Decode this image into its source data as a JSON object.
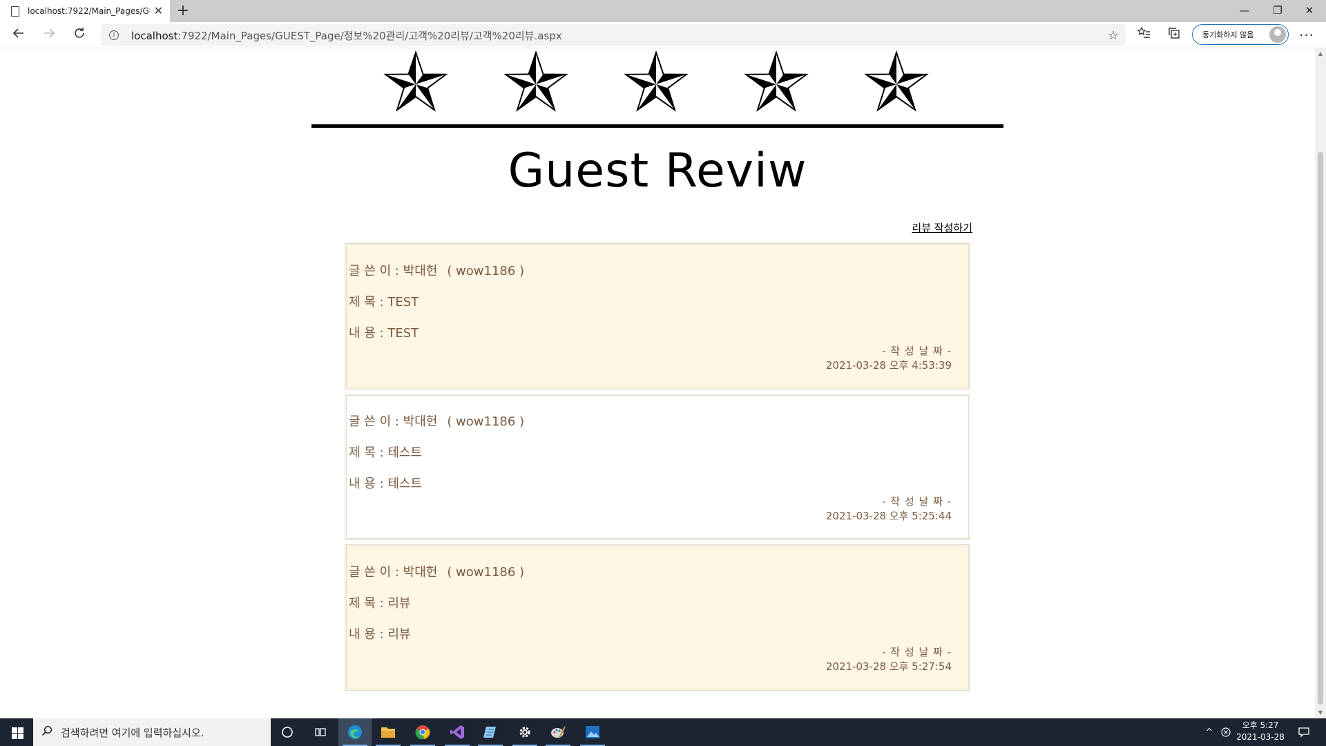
{
  "browser": {
    "tab_title": "localhost:7922/Main_Pages/GUES",
    "tab_close": "✕",
    "new_tab": "+",
    "url_host": "localhost",
    "url_rest": ":7922/Main_Pages/GUEST_Page/정보%20관리/고객%20리뷰/고객%20리뷰.aspx",
    "sync_label": "동기화하지 않음",
    "window_controls": {
      "minimize": "—",
      "restore": "❐",
      "close": "✕"
    },
    "icons": {
      "back": "back-arrow-icon",
      "forward": "forward-arrow-icon",
      "refresh": "refresh-icon",
      "info": "info-icon",
      "favorite": "star-outline-icon",
      "favorites_list": "favorites-icon",
      "collections": "collections-icon",
      "more": "more-icon"
    }
  },
  "page": {
    "rating_stars": 5,
    "title": "Guest Reviw",
    "write_link": "리뷰 작성하기"
  },
  "reviews": [
    {
      "author": "글 쓴 이 : 박대헌",
      "user_id": "( wow1186 )",
      "subject": "제 목 : TEST",
      "content": "내 용 : TEST",
      "date_label": "- 작 성 날 짜 -",
      "date": "2021-03-28 오후 4:53:39",
      "background": "#fff6e6"
    },
    {
      "author": "글 쓴 이 : 박대헌",
      "user_id": "( wow1186 )",
      "subject": "제 목 : 테스트",
      "content": "내 용 : 테스트",
      "date_label": "- 작 성 날 짜 -",
      "date": "2021-03-28 오후 5:25:44",
      "background": "#ffffff"
    },
    {
      "author": "글 쓴 이 : 박대헌",
      "user_id": "( wow1186 )",
      "subject": "제 목 : 리뷰",
      "content": "내 용 : 리뷰",
      "date_label": "- 작 성 날 짜 -",
      "date": "2021-03-28 오후 5:27:54",
      "background": "#fff6e6"
    }
  ],
  "colors": {
    "review_text": "#7b5a40",
    "review_alt_bg": "#fff6e6",
    "taskbar": "#1c2432",
    "sync_border": "#2b6fb0"
  },
  "taskbar": {
    "search_placeholder": "검색하려면 여기에 입력하십시오.",
    "apps": [
      "cortana-icon",
      "task-view-icon",
      "edge-icon",
      "file-explorer-icon",
      "chrome-icon",
      "visual-studio-icon",
      "notepad-icon",
      "settings-icon",
      "paint-icon",
      "photos-icon"
    ],
    "clock_time": "오후 5:27",
    "clock_date": "2021-03-28"
  }
}
